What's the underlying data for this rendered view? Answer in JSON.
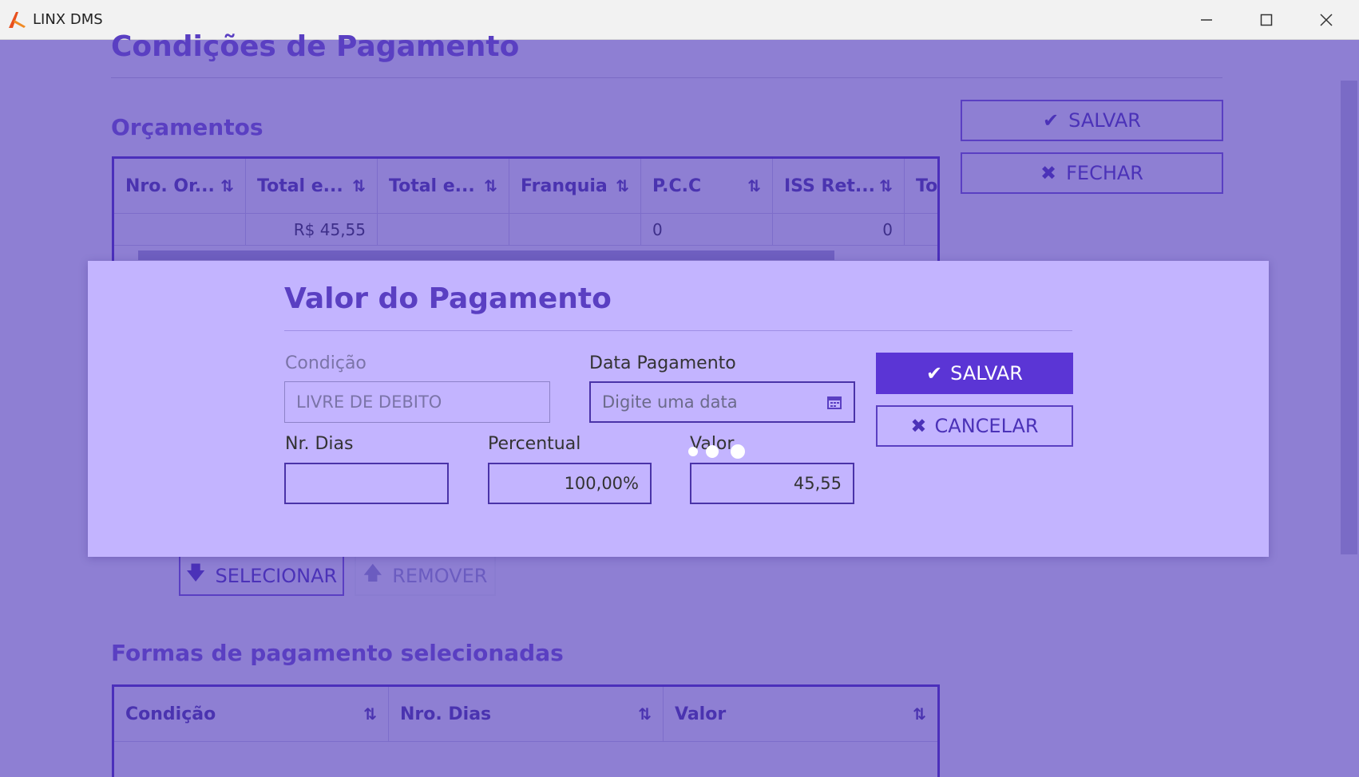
{
  "window": {
    "title": "LINX DMS",
    "minimize_icon": "minimize-icon",
    "maximize_icon": "maximize-icon",
    "close_icon": "close-icon"
  },
  "page": {
    "title": "Condições de Pagamento",
    "buttons": {
      "save": "SALVAR",
      "close": "FECHAR"
    },
    "orcamentos": {
      "title": "Orçamentos",
      "columns": [
        "Nro. Or...",
        "Total e...",
        "Total e...",
        "Franquia",
        "P.C.C",
        "ISS Ret...",
        "Tot"
      ],
      "rows": [
        [
          "",
          "R$ 45,55",
          "",
          "",
          "0",
          "0",
          ""
        ]
      ]
    },
    "actions": {
      "select": "SELECIONAR",
      "remove": "REMOVER"
    },
    "formas": {
      "title": "Formas de pagamento selecionadas",
      "columns": [
        "Condição",
        "Nro. Dias",
        "Valor"
      ]
    }
  },
  "dialog": {
    "title": "Valor do Pagamento",
    "condicao": {
      "label": "Condição",
      "value": "LIVRE DE DEBITO"
    },
    "data_pagamento": {
      "label": "Data Pagamento",
      "placeholder": "Digite uma data"
    },
    "nr_dias": {
      "label": "Nr. Dias",
      "value": ""
    },
    "percentual": {
      "label": "Percentual",
      "value": "100,00%"
    },
    "valor": {
      "label": "Valor",
      "value": "45,55"
    },
    "save": "SALVAR",
    "cancel": "CANCELAR"
  },
  "colors": {
    "overlay": "#8e7fd3",
    "dialog_bg": "#c3b4ff",
    "accent": "#5b35d5",
    "heading": "#5a3fc2"
  }
}
